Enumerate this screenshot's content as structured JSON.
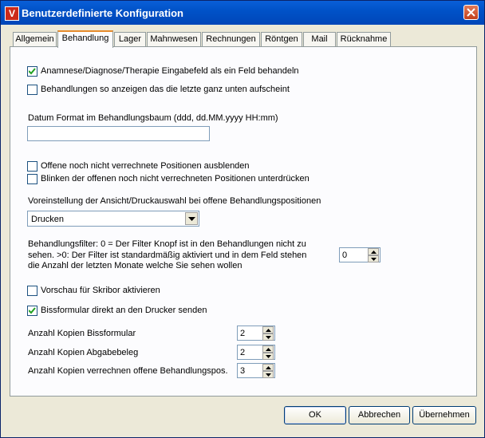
{
  "window": {
    "title": "Benutzerdefinierte Konfiguration",
    "icon_letter": "V"
  },
  "tabs": [
    "Allgemein",
    "Behandlung",
    "Lager",
    "Mahnwesen",
    "Rechnungen",
    "Röntgen",
    "Mail",
    "Rücknahme"
  ],
  "active_tab": "Behandlung",
  "options": {
    "anamnese": {
      "label": "Anamnese/Diagnose/Therapie Eingabefeld als ein Feld behandeln",
      "checked": true
    },
    "letzte_unten": {
      "label": "Behandlungen so anzeigen das die letzte ganz unten aufscheint",
      "checked": false
    },
    "datum_label": "Datum Format  im Behandlungsbaum (ddd,  dd.MM.yyyy  HH:mm)",
    "datum_value": "",
    "offene_ausblenden": {
      "label": "Offene noch nicht verrechnete Positionen ausblenden",
      "checked": false
    },
    "blinken": {
      "label": "Blinken der offenen noch nicht verrechneten Positionen unterdrücken",
      "checked": false
    },
    "voreinstellung_label": "Voreinstellung der Ansicht/Druckauswahl  bei offene Behandlungspositionen",
    "voreinstellung_value": "Drucken",
    "filter_text_1": "Behandlungsfilter: 0 = Der Filter Knopf ist in den Behandlungen nicht zu",
    "filter_text_2": "sehen. >0: Der Filter ist  standardmäßig aktiviert und in dem Feld stehen",
    "filter_text_3": "die Anzahl der letzten Monate welche Sie sehen wollen",
    "filter_value": "0",
    "skribor": {
      "label": "Vorschau für Skribor aktivieren",
      "checked": false
    },
    "biss_drucker": {
      "label": "Bissformular direkt an den  Drucker senden",
      "checked": true
    },
    "kopien": [
      {
        "label": "Anzahl Kopien Bissformular",
        "value": "2"
      },
      {
        "label": "Anzahl Kopien Abgabebeleg",
        "value": "2"
      },
      {
        "label": "Anzahl Kopien verrechnen offene Behandlungspos.",
        "value": "3"
      }
    ]
  },
  "buttons": {
    "ok": "OK",
    "abbrechen": "Abbrechen",
    "uebernehmen": "Übernehmen"
  }
}
